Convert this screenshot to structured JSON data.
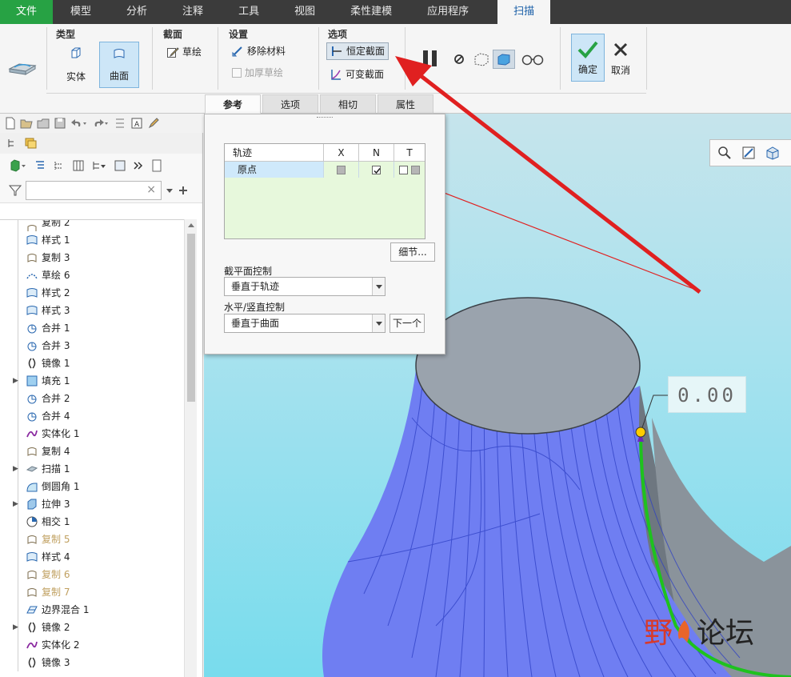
{
  "menubar": {
    "items": [
      "文件",
      "模型",
      "分析",
      "注释",
      "工具",
      "视图",
      "柔性建模",
      "应用程序",
      "扫描"
    ]
  },
  "ribbon": {
    "type_group": {
      "title": "类型",
      "solid": "实体",
      "surface": "曲面"
    },
    "section_group": {
      "title": "截面",
      "sketch": "草绘"
    },
    "settings_group": {
      "title": "设置",
      "remove_material": "移除材料",
      "thicken_sketch": "加厚草绘"
    },
    "options_group": {
      "title": "选项",
      "constant_section": "恒定截面",
      "variable_section": "可变截面"
    },
    "confirm": "确定",
    "cancel": "取消"
  },
  "dashboard_tabs": [
    "参考",
    "选项",
    "相切",
    "属性"
  ],
  "ref_panel": {
    "table_headers": {
      "trajectory": "轨迹",
      "x": "X",
      "n": "N",
      "t": "T"
    },
    "row_name": "原点",
    "details_button": "细节...",
    "section_plane_label": "截平面控制",
    "section_plane_value": "垂直于轨迹",
    "hv_control_label": "水平/竖直控制",
    "hv_control_value": "垂直于曲面",
    "next_button": "下一个"
  },
  "dimension_value": "0.00",
  "watermark": {
    "part1": "野",
    "part2": "论坛"
  },
  "model_tree": [
    {
      "label": "复制 2",
      "icon": "copy-icon",
      "expand": false,
      "disabled": false
    },
    {
      "label": "样式 1",
      "icon": "style-icon",
      "expand": false,
      "disabled": false
    },
    {
      "label": "复制 3",
      "icon": "copy-icon",
      "expand": false,
      "disabled": false
    },
    {
      "label": "草绘 6",
      "icon": "sketch-icon",
      "expand": false,
      "disabled": false
    },
    {
      "label": "样式 2",
      "icon": "style-icon",
      "expand": false,
      "disabled": false
    },
    {
      "label": "样式 3",
      "icon": "style-icon",
      "expand": false,
      "disabled": false
    },
    {
      "label": "合并 1",
      "icon": "merge-icon",
      "expand": false,
      "disabled": false
    },
    {
      "label": "合并 3",
      "icon": "merge-icon",
      "expand": false,
      "disabled": false
    },
    {
      "label": "镜像 1",
      "icon": "mirror-icon",
      "expand": false,
      "disabled": false
    },
    {
      "label": "填充 1",
      "icon": "fill-icon",
      "expand": true,
      "disabled": false
    },
    {
      "label": "合并 2",
      "icon": "merge-icon",
      "expand": false,
      "disabled": false
    },
    {
      "label": "合并 4",
      "icon": "merge-icon",
      "expand": false,
      "disabled": false
    },
    {
      "label": "实体化 1",
      "icon": "solidify-icon",
      "expand": false,
      "disabled": false
    },
    {
      "label": "复制 4",
      "icon": "copy-icon",
      "expand": false,
      "disabled": false
    },
    {
      "label": "扫描 1",
      "icon": "sweep-icon",
      "expand": true,
      "disabled": false
    },
    {
      "label": "倒圆角 1",
      "icon": "round-icon",
      "expand": false,
      "disabled": false
    },
    {
      "label": "拉伸 3",
      "icon": "extrude-icon",
      "expand": true,
      "disabled": false
    },
    {
      "label": "相交 1",
      "icon": "intersect-icon",
      "expand": false,
      "disabled": false
    },
    {
      "label": "复制 5",
      "icon": "copy-icon",
      "expand": false,
      "disabled": true
    },
    {
      "label": "样式 4",
      "icon": "style-icon",
      "expand": false,
      "disabled": false
    },
    {
      "label": "复制 6",
      "icon": "copy-icon",
      "expand": false,
      "disabled": true
    },
    {
      "label": "复制 7",
      "icon": "copy-icon",
      "expand": false,
      "disabled": true
    },
    {
      "label": "边界混合 1",
      "icon": "boundary-blend-icon",
      "expand": false,
      "disabled": false
    },
    {
      "label": "镜像 2",
      "icon": "mirror-icon",
      "expand": true,
      "disabled": false
    },
    {
      "label": "实体化 2",
      "icon": "solidify-icon",
      "expand": false,
      "disabled": false
    },
    {
      "label": "镜像 3",
      "icon": "mirror-icon",
      "expand": false,
      "disabled": false
    }
  ],
  "colors": {
    "menubar_bg": "#3b3b3b",
    "file_menu_bg": "#27a244",
    "active_tab_text": "#1a5fa8",
    "surface_blue": "#6f7ef2",
    "trajectory_green": "#1ec21e",
    "arrow_red": "#e02020"
  }
}
